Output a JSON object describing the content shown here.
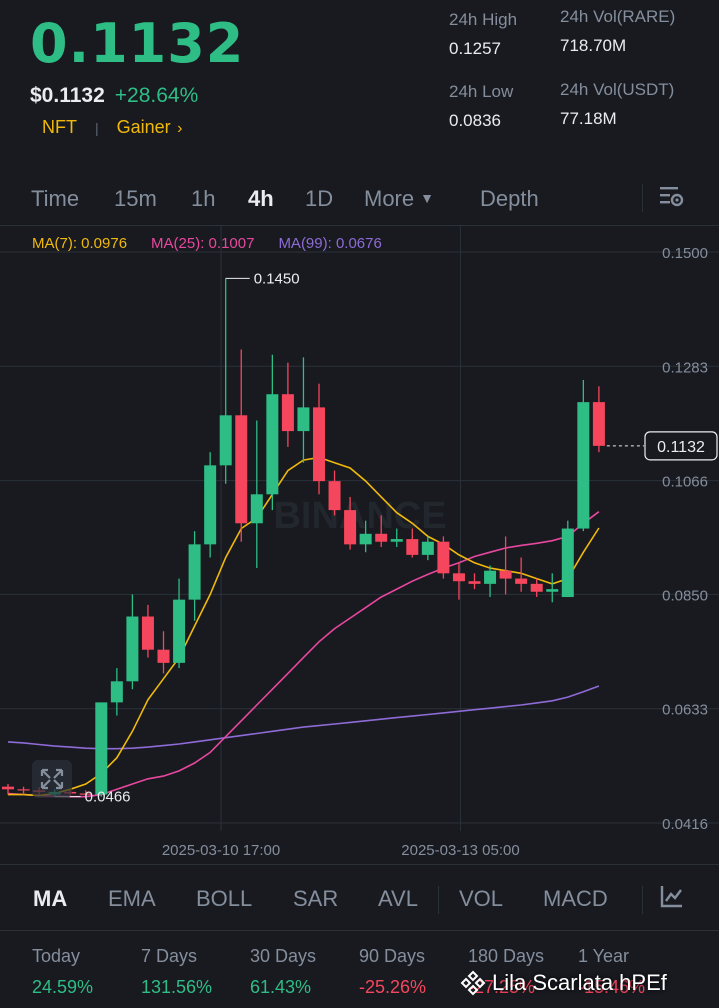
{
  "header": {
    "last_price": "0.1132",
    "fiat_price": "$0.1132",
    "change_pct": "+28.64%",
    "tag1": "NFT",
    "tag2": "Gainer",
    "high_label": "24h High",
    "high_value": "0.1257",
    "low_label": "24h Low",
    "low_value": "0.0836",
    "vol_base_label": "24h Vol(RARE)",
    "vol_base_value": "718.70M",
    "vol_quote_label": "24h Vol(USDT)",
    "vol_quote_value": "77.18M"
  },
  "interval_tabs": [
    "Time",
    "15m",
    "1h",
    "4h",
    "1D",
    "More",
    "Depth"
  ],
  "active_interval": "4h",
  "ma_legend": {
    "ma7": "MA(7): 0.0976",
    "ma25": "MA(25): 0.1007",
    "ma99": "MA(99): 0.0676"
  },
  "colors": {
    "up": "#2ebd85",
    "down": "#f6465d",
    "ma7": "#f0b90b",
    "ma25": "#e8479e",
    "ma99": "#8e6bd6",
    "accent": "#f0b90b"
  },
  "chart_data": {
    "type": "candlestick",
    "y_ticks": [
      "0.1500",
      "0.1283",
      "0.1066",
      "0.0850",
      "0.0633",
      "0.0416"
    ],
    "x_ticks": [
      "2025-03-10 17:00",
      "2025-03-13 05:00"
    ],
    "ylim": [
      0.0416,
      0.15
    ],
    "current_price_tag": "0.1132",
    "max_label": "0.1450",
    "min_label": "0.0466",
    "watermark_text": "BINANCE",
    "candles": [
      {
        "o": 0.0485,
        "h": 0.049,
        "l": 0.047,
        "c": 0.048
      },
      {
        "o": 0.048,
        "h": 0.0485,
        "l": 0.047,
        "c": 0.0478
      },
      {
        "o": 0.0478,
        "h": 0.0484,
        "l": 0.047,
        "c": 0.0475
      },
      {
        "o": 0.047,
        "h": 0.048,
        "l": 0.0466,
        "c": 0.0475
      },
      {
        "o": 0.0475,
        "h": 0.0478,
        "l": 0.0468,
        "c": 0.0472
      },
      {
        "o": 0.0472,
        "h": 0.0478,
        "l": 0.0466,
        "c": 0.047
      },
      {
        "o": 0.047,
        "h": 0.064,
        "l": 0.0466,
        "c": 0.0645
      },
      {
        "o": 0.0645,
        "h": 0.071,
        "l": 0.062,
        "c": 0.0685
      },
      {
        "o": 0.0685,
        "h": 0.085,
        "l": 0.067,
        "c": 0.0808
      },
      {
        "o": 0.0808,
        "h": 0.083,
        "l": 0.073,
        "c": 0.0745
      },
      {
        "o": 0.0745,
        "h": 0.078,
        "l": 0.07,
        "c": 0.072
      },
      {
        "o": 0.072,
        "h": 0.088,
        "l": 0.071,
        "c": 0.084
      },
      {
        "o": 0.084,
        "h": 0.097,
        "l": 0.08,
        "c": 0.0945
      },
      {
        "o": 0.0945,
        "h": 0.112,
        "l": 0.092,
        "c": 0.1095
      },
      {
        "o": 0.1095,
        "h": 0.145,
        "l": 0.106,
        "c": 0.119
      },
      {
        "o": 0.119,
        "h": 0.1315,
        "l": 0.095,
        "c": 0.0985
      },
      {
        "o": 0.0985,
        "h": 0.118,
        "l": 0.09,
        "c": 0.104
      },
      {
        "o": 0.104,
        "h": 0.1305,
        "l": 0.101,
        "c": 0.123
      },
      {
        "o": 0.123,
        "h": 0.129,
        "l": 0.113,
        "c": 0.116
      },
      {
        "o": 0.116,
        "h": 0.13,
        "l": 0.11,
        "c": 0.1205
      },
      {
        "o": 0.1205,
        "h": 0.125,
        "l": 0.104,
        "c": 0.1065
      },
      {
        "o": 0.1065,
        "h": 0.1085,
        "l": 0.1,
        "c": 0.101
      },
      {
        "o": 0.101,
        "h": 0.1035,
        "l": 0.0935,
        "c": 0.0945
      },
      {
        "o": 0.0945,
        "h": 0.099,
        "l": 0.093,
        "c": 0.0965
      },
      {
        "o": 0.0965,
        "h": 0.1,
        "l": 0.094,
        "c": 0.095
      },
      {
        "o": 0.095,
        "h": 0.0975,
        "l": 0.094,
        "c": 0.0955
      },
      {
        "o": 0.0955,
        "h": 0.0975,
        "l": 0.092,
        "c": 0.0925
      },
      {
        "o": 0.0925,
        "h": 0.096,
        "l": 0.0915,
        "c": 0.095
      },
      {
        "o": 0.095,
        "h": 0.096,
        "l": 0.088,
        "c": 0.089
      },
      {
        "o": 0.089,
        "h": 0.091,
        "l": 0.084,
        "c": 0.0875
      },
      {
        "o": 0.0875,
        "h": 0.089,
        "l": 0.086,
        "c": 0.087
      },
      {
        "o": 0.087,
        "h": 0.0905,
        "l": 0.0845,
        "c": 0.0895
      },
      {
        "o": 0.0895,
        "h": 0.096,
        "l": 0.085,
        "c": 0.088
      },
      {
        "o": 0.088,
        "h": 0.092,
        "l": 0.0855,
        "c": 0.087
      },
      {
        "o": 0.087,
        "h": 0.088,
        "l": 0.0845,
        "c": 0.0855
      },
      {
        "o": 0.0855,
        "h": 0.089,
        "l": 0.0835,
        "c": 0.086
      },
      {
        "o": 0.0845,
        "h": 0.099,
        "l": 0.0845,
        "c": 0.0975
      },
      {
        "o": 0.0975,
        "h": 0.1257,
        "l": 0.097,
        "c": 0.1215
      },
      {
        "o": 0.1215,
        "h": 0.1245,
        "l": 0.112,
        "c": 0.1132
      }
    ],
    "ma7": [
      0.047,
      0.047,
      0.0468,
      0.0472,
      0.048,
      0.049,
      0.051,
      0.054,
      0.059,
      0.065,
      0.069,
      0.073,
      0.079,
      0.085,
      0.092,
      0.0975,
      0.0995,
      0.104,
      0.1085,
      0.1105,
      0.111,
      0.11,
      0.109,
      0.1065,
      0.1035,
      0.1005,
      0.0985,
      0.096,
      0.0945,
      0.0925,
      0.091,
      0.09,
      0.0895,
      0.089,
      0.088,
      0.087,
      0.088,
      0.093,
      0.0976
    ],
    "ma25": [
      0.0472,
      0.047,
      0.0468,
      0.0467,
      0.0466,
      0.0466,
      0.047,
      0.048,
      0.049,
      0.05,
      0.0505,
      0.0515,
      0.053,
      0.055,
      0.058,
      0.061,
      0.064,
      0.067,
      0.07,
      0.073,
      0.076,
      0.0785,
      0.0805,
      0.0825,
      0.0845,
      0.086,
      0.0875,
      0.0888,
      0.09,
      0.091,
      0.0922,
      0.093,
      0.0938,
      0.0943,
      0.0947,
      0.0952,
      0.096,
      0.0985,
      0.1007
    ],
    "ma99": [
      0.057,
      0.0568,
      0.0565,
      0.0562,
      0.056,
      0.0558,
      0.0557,
      0.0557,
      0.0558,
      0.056,
      0.0563,
      0.0566,
      0.057,
      0.0574,
      0.0578,
      0.0582,
      0.0586,
      0.059,
      0.0594,
      0.0598,
      0.0601,
      0.0604,
      0.0607,
      0.061,
      0.0613,
      0.0616,
      0.0619,
      0.0622,
      0.0625,
      0.0628,
      0.0631,
      0.0634,
      0.0637,
      0.064,
      0.0644,
      0.0648,
      0.0655,
      0.0665,
      0.0676
    ]
  },
  "indicator_tabs": [
    "MA",
    "EMA",
    "BOLL",
    "SAR",
    "AVL",
    "VOL",
    "MACD"
  ],
  "active_indicator": "MA",
  "performance": [
    {
      "label": "Today",
      "value": "24.59%",
      "dir": "up"
    },
    {
      "label": "7 Days",
      "value": "131.56%",
      "dir": "up"
    },
    {
      "label": "30 Days",
      "value": "61.43%",
      "dir": "up"
    },
    {
      "label": "90 Days",
      "value": "-25.26%",
      "dir": "down"
    },
    {
      "label": "180 Days",
      "value": "-27.25%",
      "dir": "down"
    },
    {
      "label": "1 Year",
      "value": "-15.46%",
      "dir": "down"
    }
  ],
  "watermark": {
    "text": "Lila Scarlata hPEf"
  }
}
